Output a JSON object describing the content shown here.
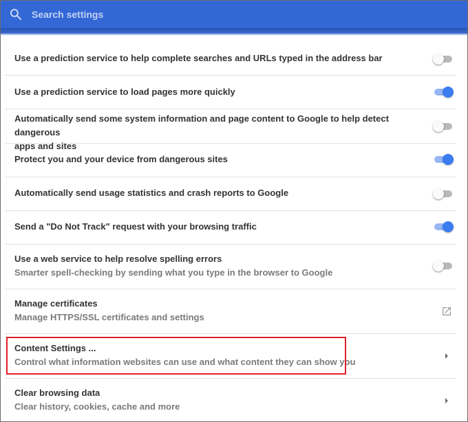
{
  "search": {
    "placeholder": "Search settings",
    "value": ""
  },
  "rows": [
    {
      "title": "Use a prediction service to help complete searches and URLs typed in the address bar",
      "control": "toggle",
      "checked": false
    },
    {
      "title": "Use a prediction service to load pages more quickly",
      "control": "toggle",
      "checked": true
    },
    {
      "title": "Automatically send some system information and page content to Google to help detect dangerous",
      "title2": "apps and sites",
      "control": "toggle",
      "checked": false
    },
    {
      "title": "Protect you and your device from dangerous sites",
      "control": "toggle",
      "checked": true
    },
    {
      "title": "Automatically send usage statistics and crash reports to Google",
      "control": "toggle",
      "checked": false
    },
    {
      "title": "Send a \"Do Not Track\" request with your browsing traffic",
      "control": "toggle",
      "checked": true
    },
    {
      "title": "Use a web service to help resolve spelling errors",
      "subtitle": "Smarter spell-checking by sending what you type in the browser to Google",
      "control": "toggle",
      "checked": false
    },
    {
      "title": "Manage certificates",
      "subtitle": "Manage HTTPS/SSL certificates and settings",
      "control": "external-link-icon"
    },
    {
      "title": "Content Settings ...",
      "subtitle": "Control what information websites can use and what content they can show you",
      "control": "chevron-right-icon"
    },
    {
      "title": "Clear browsing data",
      "subtitle": "Clear history, cookies, cache and more",
      "control": "chevron-right-icon"
    }
  ],
  "colors": {
    "header": "#3367d6",
    "toggle_on": "#3b7cf0",
    "highlight": "#e01f26"
  }
}
